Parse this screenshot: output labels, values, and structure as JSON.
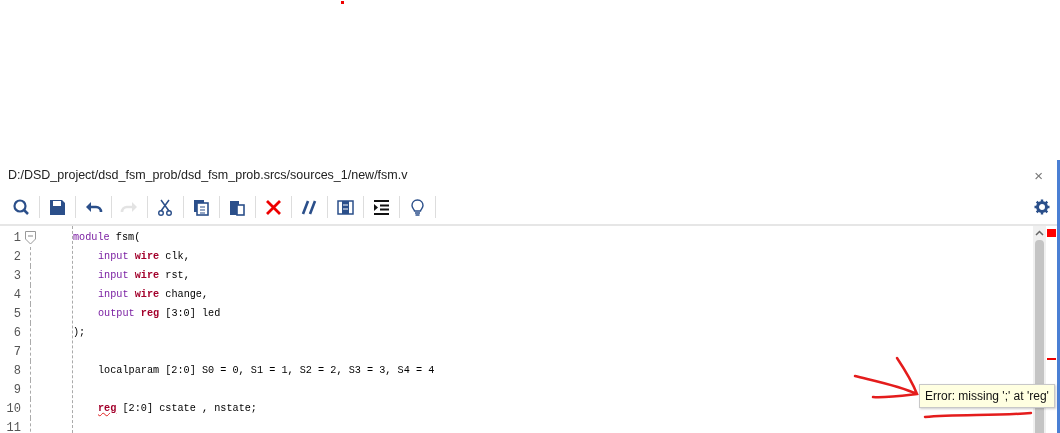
{
  "editor_tab": {
    "path": "D:/DSD_project/dsd_fsm_prob/dsd_fsm_prob.srcs/sources_1/new/fsm.v",
    "close": "×"
  },
  "toolbar": [
    {
      "kind": "search",
      "disabled": false
    },
    {
      "kind": "save",
      "disabled": false
    },
    {
      "kind": "undo",
      "disabled": false
    },
    {
      "kind": "redo",
      "disabled": true
    },
    {
      "kind": "cut",
      "disabled": false
    },
    {
      "kind": "copy",
      "disabled": false
    },
    {
      "kind": "paste",
      "disabled": false
    },
    {
      "kind": "delete",
      "disabled": false
    },
    {
      "kind": "comment",
      "disabled": false
    },
    {
      "kind": "columns",
      "disabled": false
    },
    {
      "kind": "indent",
      "disabled": false
    },
    {
      "kind": "hint",
      "disabled": false
    }
  ],
  "code_lines": [
    {
      "number": "1",
      "foldable": true,
      "indented": false,
      "tokens": [
        {
          "text": "module",
          "kind": "keyword",
          "error": false
        },
        {
          "text": "fsm(",
          "kind": "plain",
          "error": false
        }
      ]
    },
    {
      "number": "2",
      "foldable": false,
      "indented": true,
      "tokens": [
        {
          "text": "input",
          "kind": "keyword",
          "error": false
        },
        {
          "text": "wire",
          "kind": "type",
          "error": false
        },
        {
          "text": "clk,",
          "kind": "plain",
          "error": false
        }
      ]
    },
    {
      "number": "3",
      "foldable": false,
      "indented": true,
      "tokens": [
        {
          "text": "input",
          "kind": "keyword",
          "error": false
        },
        {
          "text": "wire",
          "kind": "type",
          "error": false
        },
        {
          "text": "rst,",
          "kind": "plain",
          "error": false
        }
      ]
    },
    {
      "number": "4",
      "foldable": false,
      "indented": true,
      "tokens": [
        {
          "text": "input",
          "kind": "keyword",
          "error": false
        },
        {
          "text": "wire",
          "kind": "type",
          "error": false
        },
        {
          "text": "change,",
          "kind": "plain",
          "error": false
        }
      ]
    },
    {
      "number": "5",
      "foldable": false,
      "indented": true,
      "tokens": [
        {
          "text": "output",
          "kind": "keyword",
          "error": false
        },
        {
          "text": "reg",
          "kind": "type",
          "error": false
        },
        {
          "text": "[3:0] led",
          "kind": "plain",
          "error": false
        }
      ]
    },
    {
      "number": "6",
      "foldable": false,
      "indented": false,
      "tokens": [
        {
          "text": ");",
          "kind": "plain",
          "error": false
        }
      ]
    },
    {
      "number": "7",
      "foldable": false
    },
    {
      "number": "8",
      "foldable": false,
      "indented": true,
      "tokens": [
        {
          "text": "localparam [2:0] S0 = 0, S1 = 1, S2 = 2, S3 = 3, S4 = 4",
          "kind": "plain",
          "error": false
        }
      ]
    },
    {
      "number": "9",
      "foldable": false
    },
    {
      "number": "10",
      "foldable": false,
      "indented": true,
      "tokens": [
        {
          "text": "reg",
          "kind": "type",
          "error": true
        },
        {
          "text": "[2:0] cstate , nstate;",
          "kind": "plain",
          "error": false
        }
      ]
    },
    {
      "number": "11",
      "foldable": false
    }
  ],
  "tooltip": {
    "text": "Error: missing ';' at 'reg'"
  }
}
